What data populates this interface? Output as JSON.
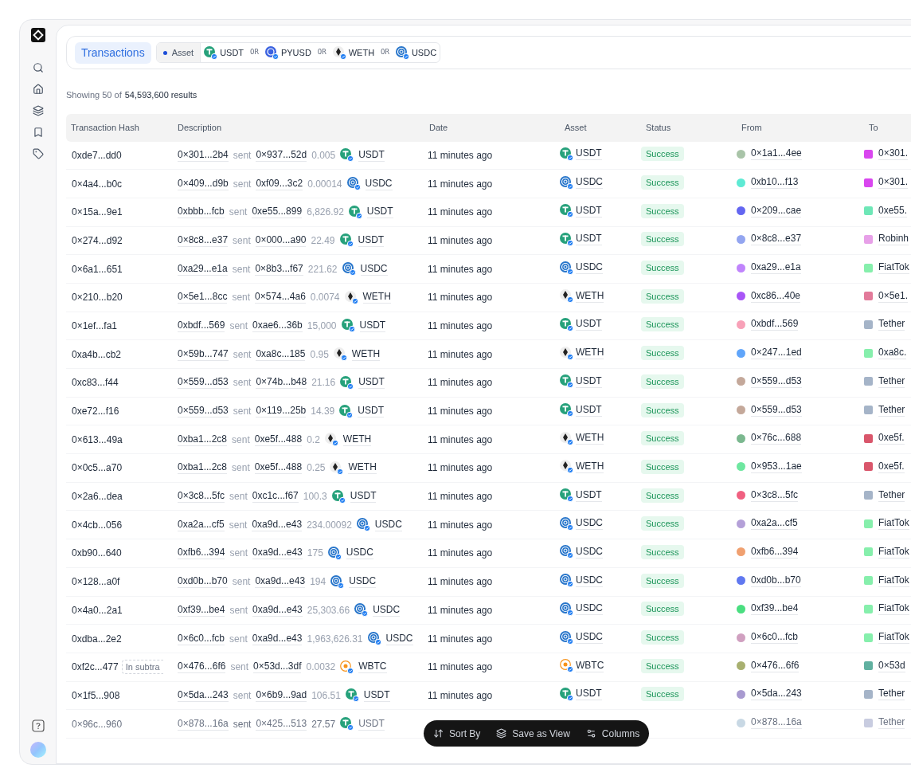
{
  "header": {
    "title": "Transactions",
    "filter": {
      "label": "Asset",
      "tokens": [
        {
          "symbol": "USDT",
          "kind": "tether"
        },
        {
          "joiner": "OR",
          "symbol": "PYUSD",
          "kind": "pyusd"
        },
        {
          "joiner": "OR",
          "symbol": "WETH",
          "kind": "weth"
        },
        {
          "joiner": "OR",
          "symbol": "USDC",
          "kind": "usdc"
        }
      ]
    }
  },
  "summary": {
    "prefix": "Showing 50 of",
    "count": "54,593,600 results"
  },
  "table": {
    "columns": [
      "Transaction Hash",
      "Description",
      "Date",
      "Asset",
      "Status",
      "From",
      "To"
    ],
    "rows": [
      {
        "hash": "0xde7...dd0",
        "desc": {
          "from": "0×301...2b4",
          "verb": "sent",
          "to": "0×937...52d",
          "amount": "0.005",
          "token": "USDT",
          "kind": "tether"
        },
        "date": "11 minutes ago",
        "asset": {
          "symbol": "USDT",
          "kind": "tether"
        },
        "status": "Success",
        "from": {
          "label": "0×1a1...4ee",
          "color": "#a9c4a8"
        },
        "to": {
          "label": "0×301.",
          "color": "#d946ef"
        },
        "dimmed": false
      },
      {
        "hash": "0×4a4...b0c",
        "desc": {
          "from": "0×409...d9b",
          "verb": "sent",
          "to": "0xf09...3c2",
          "amount": "0.00014",
          "token": "USDC",
          "kind": "usdc"
        },
        "date": "11 minutes ago",
        "asset": {
          "symbol": "USDC",
          "kind": "usdc"
        },
        "status": "Success",
        "from": {
          "label": "0xb10...f13",
          "color": "#5eead4"
        },
        "to": {
          "label": "0×301.",
          "color": "#d946ef"
        },
        "dimmed": false
      },
      {
        "hash": "0×15a...9e1",
        "desc": {
          "from": "0xbbb...fcb",
          "verb": "sent",
          "to": "0xe55...899",
          "amount": "6,826.92",
          "token": "USDT",
          "kind": "tether"
        },
        "date": "11 minutes ago",
        "asset": {
          "symbol": "USDT",
          "kind": "tether"
        },
        "status": "Success",
        "from": {
          "label": "0×209...cae",
          "color": "#6366f1"
        },
        "to": {
          "label": "0xe55.",
          "color": "#6ee7b7"
        },
        "dimmed": false
      },
      {
        "hash": "0×274...d92",
        "desc": {
          "from": "0×8c8...e37",
          "verb": "sent",
          "to": "0×000...a90",
          "amount": "22.49",
          "token": "USDT",
          "kind": "tether"
        },
        "date": "11 minutes ago",
        "asset": {
          "symbol": "USDT",
          "kind": "tether"
        },
        "status": "Success",
        "from": {
          "label": "0×8c8...e37",
          "color": "#93a5f0"
        },
        "to": {
          "label": "Robinh",
          "color": "#e7a0e8"
        },
        "dimmed": false
      },
      {
        "hash": "0×6a1...651",
        "desc": {
          "from": "0xa29...e1a",
          "verb": "sent",
          "to": "0×8b3...f67",
          "amount": "221.62",
          "token": "USDC",
          "kind": "usdc"
        },
        "date": "11 minutes ago",
        "asset": {
          "symbol": "USDC",
          "kind": "usdc"
        },
        "status": "Success",
        "from": {
          "label": "0xa29...e1a",
          "color": "#c084fc"
        },
        "to": {
          "label": "FiatTok",
          "color": "#86efac"
        },
        "dimmed": false
      },
      {
        "hash": "0×210...b20",
        "desc": {
          "from": "0×5e1...8cc",
          "verb": "sent",
          "to": "0×574...4a6",
          "amount": "0.0074",
          "token": "WETH",
          "kind": "weth"
        },
        "date": "11 minutes ago",
        "asset": {
          "symbol": "WETH",
          "kind": "weth"
        },
        "status": "Success",
        "from": {
          "label": "0xc86...40e",
          "color": "#a855f7"
        },
        "to": {
          "label": "0×5e1.",
          "color": "#e27a9a"
        },
        "dimmed": false
      },
      {
        "hash": "0×1ef...fa1",
        "desc": {
          "from": "0xbdf...569",
          "verb": "sent",
          "to": "0xae6...36b",
          "amount": "15,000",
          "token": "USDT",
          "kind": "tether"
        },
        "date": "11 minutes ago",
        "asset": {
          "symbol": "USDT",
          "kind": "tether"
        },
        "status": "Success",
        "from": {
          "label": "0xbdf...569",
          "color": "#f8a1b8"
        },
        "to": {
          "label": "Tether",
          "color": "#a5b4c8"
        },
        "dimmed": false
      },
      {
        "hash": "0xa4b...cb2",
        "desc": {
          "from": "0×59b...747",
          "verb": "sent",
          "to": "0xa8c...185",
          "amount": "0.95",
          "token": "WETH",
          "kind": "weth"
        },
        "date": "11 minutes ago",
        "asset": {
          "symbol": "WETH",
          "kind": "weth"
        },
        "status": "Success",
        "from": {
          "label": "0×247...1ed",
          "color": "#60a5fa"
        },
        "to": {
          "label": "0xa8c.",
          "color": "#86efac"
        },
        "dimmed": false
      },
      {
        "hash": "0xc83...f44",
        "desc": {
          "from": "0×559...d53",
          "verb": "sent",
          "to": "0×74b...b48",
          "amount": "21.16",
          "token": "USDT",
          "kind": "tether"
        },
        "date": "11 minutes ago",
        "asset": {
          "symbol": "USDT",
          "kind": "tether"
        },
        "status": "Success",
        "from": {
          "label": "0×559...d53",
          "color": "#c4a89a"
        },
        "to": {
          "label": "Tether",
          "color": "#a5b4c8"
        },
        "dimmed": false
      },
      {
        "hash": "0xe72...f16",
        "desc": {
          "from": "0×559...d53",
          "verb": "sent",
          "to": "0×119...25b",
          "amount": "14.39",
          "token": "USDT",
          "kind": "tether"
        },
        "date": "11 minutes ago",
        "asset": {
          "symbol": "USDT",
          "kind": "tether"
        },
        "status": "Success",
        "from": {
          "label": "0×559...d53",
          "color": "#c4a89a"
        },
        "to": {
          "label": "Tether",
          "color": "#a5b4c8"
        },
        "dimmed": false
      },
      {
        "hash": "0×613...49a",
        "desc": {
          "from": "0xba1...2c8",
          "verb": "sent",
          "to": "0xe5f...488",
          "amount": "0.2",
          "token": "WETH",
          "kind": "weth"
        },
        "date": "11 minutes ago",
        "asset": {
          "symbol": "WETH",
          "kind": "weth"
        },
        "status": "Success",
        "from": {
          "label": "0×76c...688",
          "color": "#7bb88f"
        },
        "to": {
          "label": "0xe5f.",
          "color": "#d9566b"
        },
        "dimmed": false
      },
      {
        "hash": "0×0c5...a70",
        "desc": {
          "from": "0xba1...2c8",
          "verb": "sent",
          "to": "0xe5f...488",
          "amount": "0.25",
          "token": "WETH",
          "kind": "weth"
        },
        "date": "11 minutes ago",
        "asset": {
          "symbol": "WETH",
          "kind": "weth"
        },
        "status": "Success",
        "from": {
          "label": "0×953...1ae",
          "color": "#6ee7a0"
        },
        "to": {
          "label": "0xe5f.",
          "color": "#d9566b"
        },
        "dimmed": false
      },
      {
        "hash": "0×2a6...dea",
        "desc": {
          "from": "0×3c8...5fc",
          "verb": "sent",
          "to": "0xc1c...f67",
          "amount": "100.3",
          "token": "USDT",
          "kind": "tether"
        },
        "date": "11 minutes ago",
        "asset": {
          "symbol": "USDT",
          "kind": "tether"
        },
        "status": "Success",
        "from": {
          "label": "0×3c8...5fc",
          "color": "#f06080"
        },
        "to": {
          "label": "Tether",
          "color": "#a5b4c8"
        },
        "dimmed": false
      },
      {
        "hash": "0×4cb...056",
        "desc": {
          "from": "0xa2a...cf5",
          "verb": "sent",
          "to": "0xa9d...e43",
          "amount": "234.00092",
          "token": "USDC",
          "kind": "usdc"
        },
        "date": "11 minutes ago",
        "asset": {
          "symbol": "USDC",
          "kind": "usdc"
        },
        "status": "Success",
        "from": {
          "label": "0xa2a...cf5",
          "color": "#b4a0d8"
        },
        "to": {
          "label": "FiatTok",
          "color": "#86efac"
        },
        "dimmed": false
      },
      {
        "hash": "0xb90...640",
        "desc": {
          "from": "0xfb6...394",
          "verb": "sent",
          "to": "0xa9d...e43",
          "amount": "175",
          "token": "USDC",
          "kind": "usdc"
        },
        "date": "11 minutes ago",
        "asset": {
          "symbol": "USDC",
          "kind": "usdc"
        },
        "status": "Success",
        "from": {
          "label": "0xfb6...394",
          "color": "#f0a070"
        },
        "to": {
          "label": "FiatTok",
          "color": "#86efac"
        },
        "dimmed": false
      },
      {
        "hash": "0×128...a0f",
        "desc": {
          "from": "0xd0b...b70",
          "verb": "sent",
          "to": "0xa9d...e43",
          "amount": "194",
          "token": "USDC",
          "kind": "usdc"
        },
        "date": "11 minutes ago",
        "asset": {
          "symbol": "USDC",
          "kind": "usdc"
        },
        "status": "Success",
        "from": {
          "label": "0xd0b...b70",
          "color": "#6078f0"
        },
        "to": {
          "label": "FiatTok",
          "color": "#86efac"
        },
        "dimmed": false
      },
      {
        "hash": "0×4a0...2a1",
        "desc": {
          "from": "0xf39...be4",
          "verb": "sent",
          "to": "0xa9d...e43",
          "amount": "25,303.66",
          "token": "USDC",
          "kind": "usdc"
        },
        "date": "11 minutes ago",
        "asset": {
          "symbol": "USDC",
          "kind": "usdc"
        },
        "status": "Success",
        "from": {
          "label": "0xf39...be4",
          "color": "#4ade80"
        },
        "to": {
          "label": "FiatTok",
          "color": "#86efac"
        },
        "dimmed": false
      },
      {
        "hash": "0xdba...2e2",
        "desc": {
          "from": "0×6c0...fcb",
          "verb": "sent",
          "to": "0xa9d...e43",
          "amount": "1,963,626.31",
          "token": "USDC",
          "kind": "usdc"
        },
        "date": "11 minutes ago",
        "asset": {
          "symbol": "USDC",
          "kind": "usdc"
        },
        "status": "Success",
        "from": {
          "label": "0×6c0...fcb",
          "color": "#d0a0c0"
        },
        "to": {
          "label": "FiatTok",
          "color": "#86efac"
        },
        "dimmed": false
      },
      {
        "hash": "0xf2c...477",
        "tag": "In subtra",
        "desc": {
          "from": "0×476...6f6",
          "verb": "sent",
          "to": "0×53d...3df",
          "amount": "0.0032",
          "token": "WBTC",
          "kind": "wbtc"
        },
        "date": "11 minutes ago",
        "asset": {
          "symbol": "WBTC",
          "kind": "wbtc"
        },
        "status": "Success",
        "from": {
          "label": "0×476...6f6",
          "color": "#a8b070"
        },
        "to": {
          "label": "0×53d",
          "color": "#60b0a0"
        },
        "dimmed": false
      },
      {
        "hash": "0×1f5...908",
        "desc": {
          "from": "0×5da...243",
          "verb": "sent",
          "to": "0×6b9...9ad",
          "amount": "106.51",
          "token": "USDT",
          "kind": "tether"
        },
        "date": "11 minutes ago",
        "asset": {
          "symbol": "USDT",
          "kind": "tether"
        },
        "status": "Success",
        "from": {
          "label": "0×5da...243",
          "color": "#a89ad0"
        },
        "to": {
          "label": "Tether",
          "color": "#a5b4c8"
        },
        "dimmed": false
      },
      {
        "hash": "0×96c...960",
        "desc": {
          "from": "0×878...16a",
          "verb": "sent",
          "to": "0×425...513",
          "amount": "27.57",
          "token": "USDT",
          "kind": "tether"
        },
        "from": {
          "label": "0×878...16a",
          "color": "#c8d8e4"
        },
        "to": {
          "label": "Tether",
          "color": "#c8cce0"
        },
        "dimmed": true
      }
    ]
  },
  "toolbar": [
    {
      "label": "Sort By",
      "kind": "sort"
    },
    {
      "label": "Save as View",
      "kind": "view"
    },
    {
      "label": "Columns",
      "kind": "columns"
    }
  ]
}
